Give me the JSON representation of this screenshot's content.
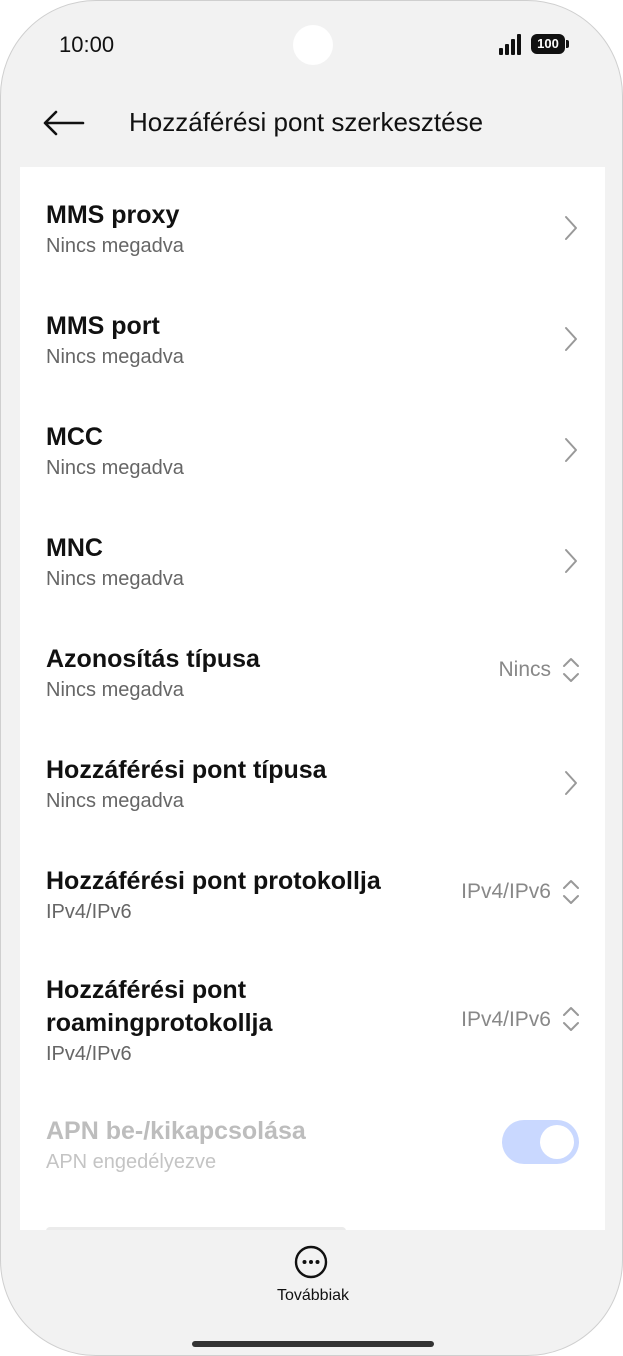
{
  "status_bar": {
    "time": "10:00",
    "battery": "100"
  },
  "header": {
    "title": "Hozzáférési pont szerkesztése"
  },
  "settings": [
    {
      "title": "MMS proxy",
      "subtitle": "Nincs megadva",
      "control": "chevron"
    },
    {
      "title": "MMS port",
      "subtitle": "Nincs megadva",
      "control": "chevron"
    },
    {
      "title": "MCC",
      "subtitle": "Nincs megadva",
      "control": "chevron"
    },
    {
      "title": "MNC",
      "subtitle": "Nincs megadva",
      "control": "chevron"
    },
    {
      "title": "Azonosítás típusa",
      "subtitle": "Nincs megadva",
      "control": "select",
      "value": "Nincs"
    },
    {
      "title": "Hozzáférési pont típusa",
      "subtitle": "Nincs megadva",
      "control": "chevron"
    },
    {
      "title": "Hozzáférési pont protokollja",
      "subtitle": "IPv4/IPv6",
      "control": "select",
      "value": "IPv4/IPv6"
    },
    {
      "title_line1": "Hozzáférési pont",
      "title_line2": "roamingprotokollja",
      "subtitle": "IPv4/IPv6",
      "control": "select",
      "value": "IPv4/IPv6"
    },
    {
      "title": "APN be-/kikapcsolása",
      "subtitle": "APN engedélyezve",
      "control": "toggle",
      "enabled": false,
      "checked": true
    }
  ],
  "bottom_bar": {
    "more_label": "Továbbiak"
  },
  "colors": {
    "background": "#f2f2f2",
    "card": "#ffffff",
    "toggle_on_disabled": "#c9d8ff"
  }
}
